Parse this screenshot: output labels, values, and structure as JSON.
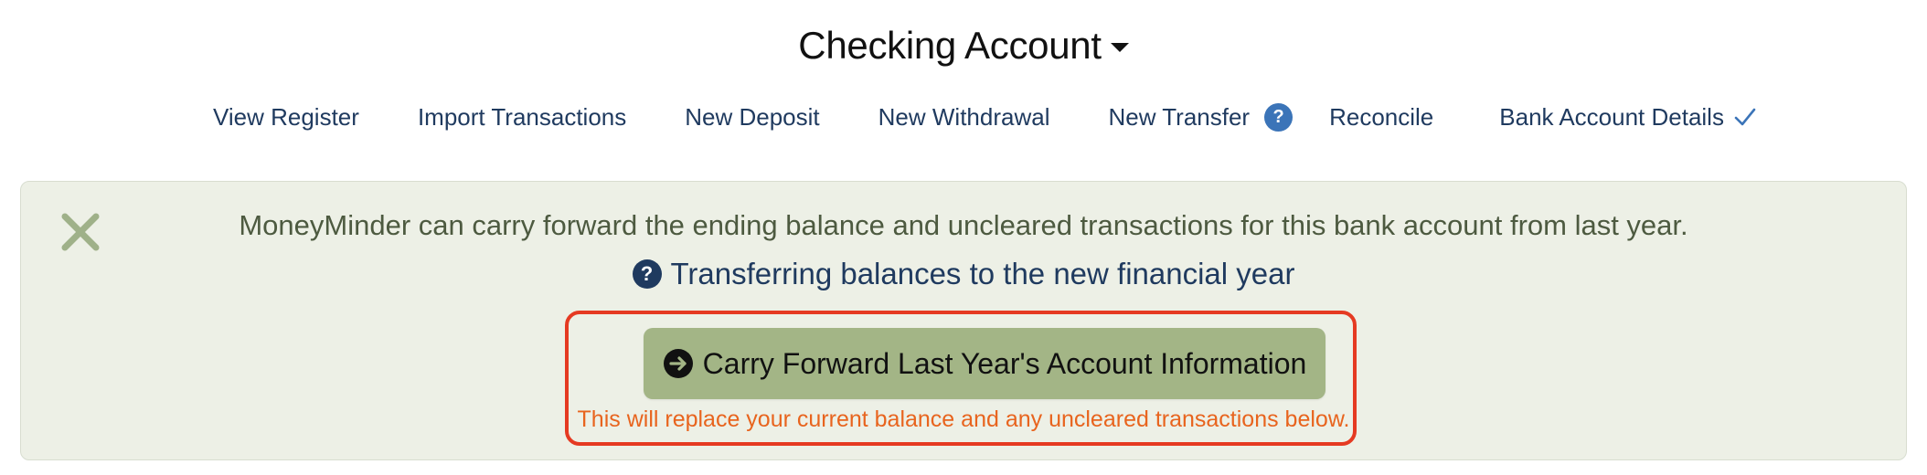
{
  "header": {
    "account_title": "Checking Account",
    "account_menu_icon": "caret-down-icon"
  },
  "nav": {
    "items": [
      {
        "label": "View Register"
      },
      {
        "label": "Import Transactions"
      },
      {
        "label": "New Deposit"
      },
      {
        "label": "New Withdrawal"
      },
      {
        "label": "New Transfer",
        "help_icon": "question-circle-icon",
        "help_text": "?"
      },
      {
        "label": "Reconcile"
      },
      {
        "label": "Bank Account Details",
        "status_icon": "check-icon"
      }
    ]
  },
  "banner": {
    "close_icon": "close-x-icon",
    "message": "MoneyMinder can carry forward the ending balance and uncleared transactions for this bank account from last year.",
    "help_link_icon": "question-circle-icon",
    "help_link_icon_text": "?",
    "help_link_label": "Transferring balances to the new financial year",
    "cta_icon": "arrow-right-circle-icon",
    "cta_label": "Carry Forward Last Year's Account Information",
    "warning": "This will replace your current balance and any uncleared transactions below."
  },
  "colors": {
    "nav_text": "#1f3a5f",
    "banner_bg": "#edf0e6",
    "cta_bg": "#a3b586",
    "warning_text": "#e8641e",
    "highlight_border": "#e53a22",
    "help_badge": "#3b74b8"
  }
}
